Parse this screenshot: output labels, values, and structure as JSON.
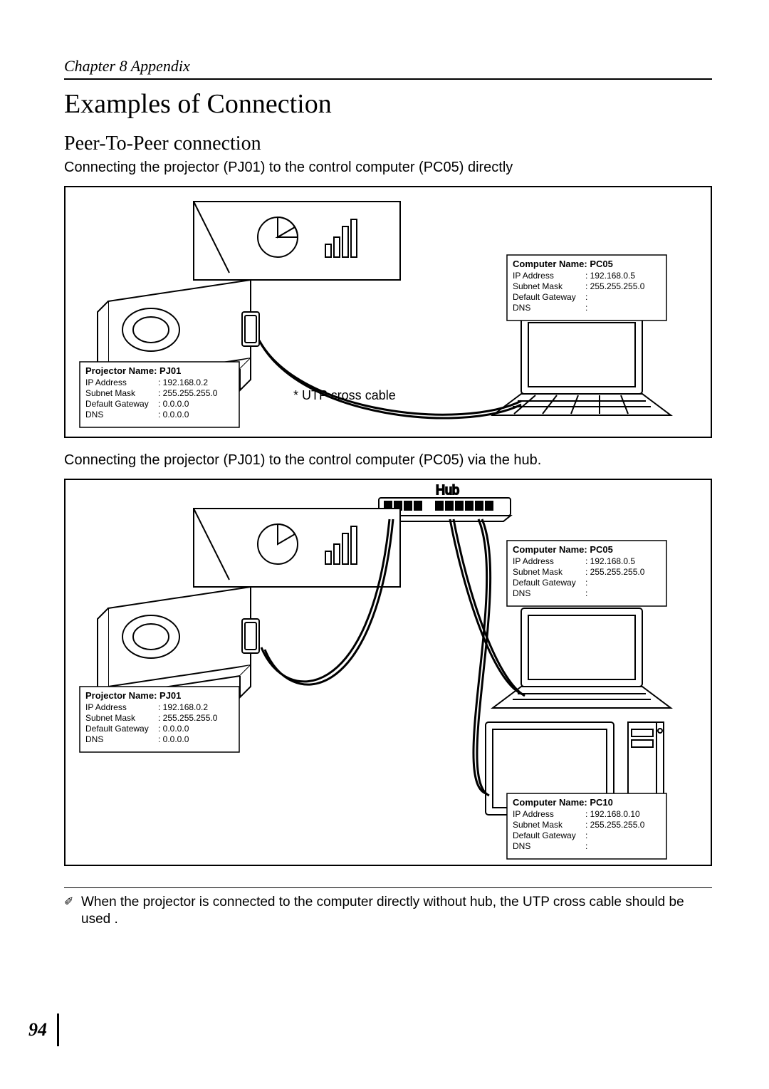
{
  "chapter_header": "Chapter 8 Appendix",
  "main_title": "Examples of Connection",
  "sub_title": "Peer-To-Peer connection",
  "desc1": "Connecting the projector (PJ01) to the control computer (PC05) directly",
  "desc2": "Connecting the projector (PJ01) to the control computer (PC05) via the hub.",
  "cable_label": "* UTP cross cable",
  "hub_label": "Hub",
  "projector_box": {
    "title": "Projector Name: PJ01",
    "rows": [
      {
        "k": "IP Address",
        "v": ": 192.168.0.2"
      },
      {
        "k": "Subnet Mask",
        "v": ": 255.255.255.0"
      },
      {
        "k": "Default Gateway",
        "v": ": 0.0.0.0"
      },
      {
        "k": "DNS",
        "v": ": 0.0.0.0"
      }
    ]
  },
  "pc05_box": {
    "title": "Computer Name: PC05",
    "rows": [
      {
        "k": "IP Address",
        "v": ": 192.168.0.5"
      },
      {
        "k": "Subnet Mask",
        "v": ": 255.255.255.0"
      },
      {
        "k": "Default Gateway",
        "v": ":"
      },
      {
        "k": "DNS",
        "v": ":"
      }
    ]
  },
  "pc10_box": {
    "title": "Computer Name: PC10",
    "rows": [
      {
        "k": "IP Address",
        "v": ": 192.168.0.10"
      },
      {
        "k": "Subnet Mask",
        "v": ": 255.255.255.0"
      },
      {
        "k": "Default Gateway",
        "v": ":"
      },
      {
        "k": "DNS",
        "v": ":"
      }
    ]
  },
  "footnote": "When the projector is connected to the computer directly without hub, the UTP cross cable should be used .",
  "page_number": "94"
}
